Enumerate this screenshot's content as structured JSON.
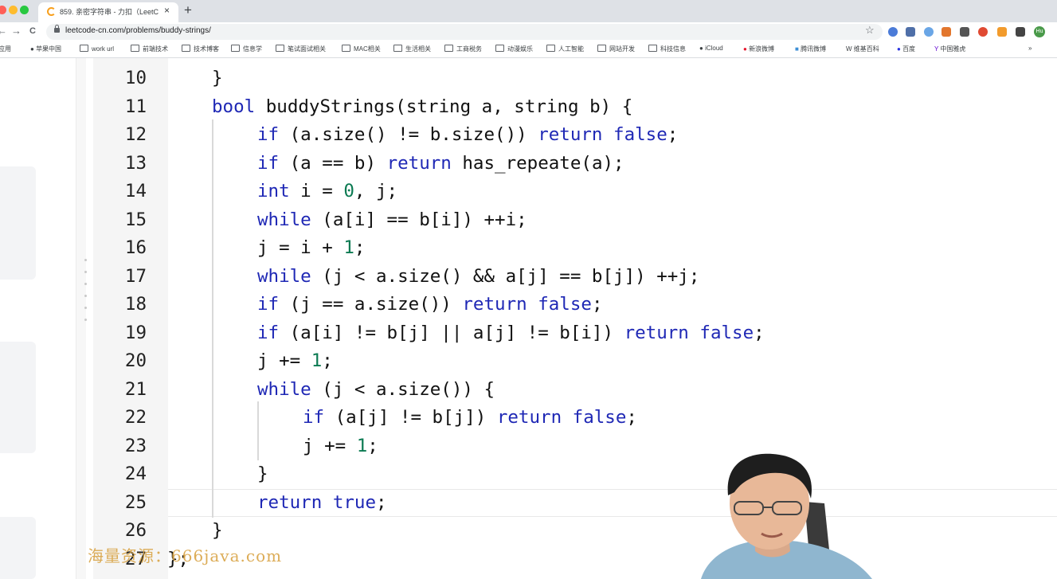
{
  "browser": {
    "tab_title": "859. 亲密字符串 - 力扣（LeetCo",
    "tab_close": "×",
    "new_tab": "+",
    "url": "leetcode-cn.com/problems/buddy-strings/",
    "nav_back": "←",
    "nav_forward": "→",
    "nav_reload": "C",
    "star": "☆",
    "profile_initials": "Hu",
    "bookmarks_more": "»",
    "bookmarks": [
      "应用",
      "苹果中国",
      "work url",
      "前端技术",
      "技术博客",
      "信息学",
      "笔试面试相关",
      "MAC相关",
      "生活相关",
      "工商税务",
      "动漫娱乐",
      "人工智能",
      "网站开发",
      "科技信息",
      "iCloud",
      "新浪微博",
      "腾讯微博",
      "维基百科",
      "百度",
      "中国雅虎"
    ]
  },
  "editor": {
    "line_numbers": [
      "10",
      "11",
      "12",
      "13",
      "14",
      "15",
      "16",
      "17",
      "18",
      "19",
      "20",
      "21",
      "22",
      "23",
      "24",
      "25",
      "26",
      "27"
    ],
    "lines": [
      [
        [
          "t",
          "}"
        ]
      ],
      [
        [
          "k",
          "bool"
        ],
        [
          "t",
          " buddyStrings(string a, string b) {"
        ]
      ],
      [
        [
          "k",
          "if"
        ],
        [
          "t",
          " (a.size() != b.size()) "
        ],
        [
          "k",
          "return false"
        ],
        [
          "t",
          ";"
        ]
      ],
      [
        [
          "k",
          "if"
        ],
        [
          "t",
          " (a == b) "
        ],
        [
          "k",
          "return"
        ],
        [
          "t",
          " has_repeate(a);"
        ]
      ],
      [
        [
          "k",
          "int"
        ],
        [
          "t",
          " i = "
        ],
        [
          "n",
          "0"
        ],
        [
          "t",
          ", j;"
        ]
      ],
      [
        [
          "k",
          "while"
        ],
        [
          "t",
          " (a[i] == b[i]) ++i;"
        ]
      ],
      [
        [
          "t",
          "j = i + "
        ],
        [
          "n",
          "1"
        ],
        [
          "t",
          ";"
        ]
      ],
      [
        [
          "k",
          "while"
        ],
        [
          "t",
          " (j < a.size() && a[j] == b[j]) ++j;"
        ]
      ],
      [
        [
          "k",
          "if"
        ],
        [
          "t",
          " (j == a.size()) "
        ],
        [
          "k",
          "return false"
        ],
        [
          "t",
          ";"
        ]
      ],
      [
        [
          "k",
          "if"
        ],
        [
          "t",
          " (a[i] != b[j] || a[j] != b[i]) "
        ],
        [
          "k",
          "return false"
        ],
        [
          "t",
          ";"
        ]
      ],
      [
        [
          "t",
          "j += "
        ],
        [
          "n",
          "1"
        ],
        [
          "t",
          ";"
        ]
      ],
      [
        [
          "k",
          "while"
        ],
        [
          "t",
          " (j < a.size()) {"
        ]
      ],
      [
        [
          "k",
          "if"
        ],
        [
          "t",
          " (a[j] != b[j]) "
        ],
        [
          "k",
          "return false"
        ],
        [
          "t",
          ";"
        ]
      ],
      [
        [
          "t",
          "j += "
        ],
        [
          "n",
          "1"
        ],
        [
          "t",
          ";"
        ]
      ],
      [
        [
          "t",
          "}"
        ]
      ],
      [
        [
          "k",
          "return true"
        ],
        [
          "t",
          ";"
        ]
      ],
      [
        [
          "t",
          "}"
        ]
      ],
      [
        [
          "t",
          "};"
        ]
      ]
    ]
  },
  "watermark": "海量资源：666java.com"
}
